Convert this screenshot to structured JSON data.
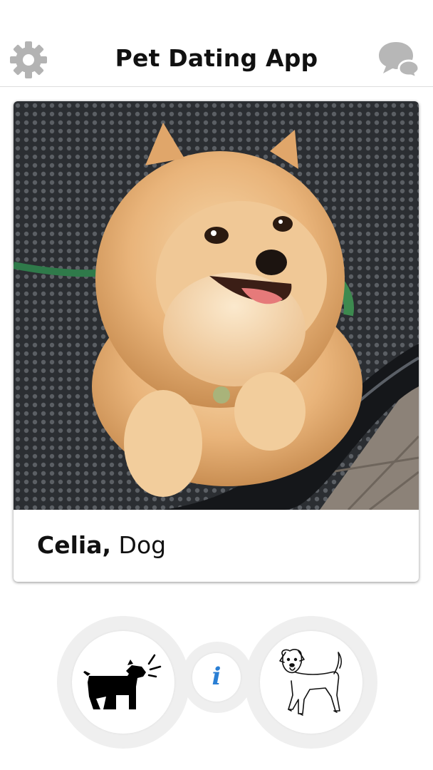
{
  "header": {
    "title": "Pet Dating App",
    "settings_icon": "gear-icon",
    "messages_icon": "chat-bubbles-icon"
  },
  "profile": {
    "name": "Celia,",
    "species": "Dog",
    "photo_subject": "pomeranian-on-bench"
  },
  "actions": {
    "reject_icon": "barking-dog-icon",
    "info_label": "i",
    "like_icon": "happy-dog-icon"
  },
  "colors": {
    "accent": "#2a7fd4",
    "icon_gray": "#b3b3b3",
    "ring_gray": "#efefef",
    "title_text": "#111111"
  }
}
